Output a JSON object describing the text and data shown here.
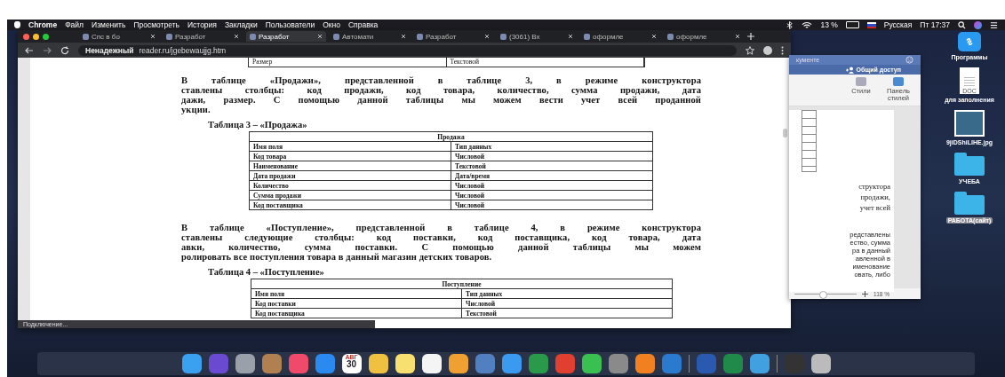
{
  "menu_bar": {
    "app": "Chrome",
    "items": [
      "Файл",
      "Изменить",
      "Просмотреть",
      "История",
      "Закладки",
      "Пользователи",
      "Окно",
      "Справка"
    ],
    "battery": "13 %",
    "input_source": "Русская",
    "clock": "Пт 17:37"
  },
  "browser": {
    "tabs": [
      {
        "label": "Спс в бо",
        "selected": false
      },
      {
        "label": "Разработ",
        "selected": false
      },
      {
        "label": "Разработ",
        "selected": true
      },
      {
        "label": "Автомати",
        "selected": false
      },
      {
        "label": "Разработ",
        "selected": false
      },
      {
        "label": "(3061) Вх",
        "selected": false
      },
      {
        "label": "оформле",
        "selected": false
      },
      {
        "label": "оформле",
        "selected": false
      }
    ],
    "address": {
      "security": "Ненадежный",
      "url": "reader.ru/jgebewaujjg.htm"
    },
    "status": "Подключение...",
    "document": {
      "top_row": [
        "Размер",
        "Текстовой"
      ],
      "paragraph_1": [
        "В таблице «Продажи», представленной в таблице 3, в режиме конструктора",
        "ставлены столбцы: код продажи, код товара, количество, сумма продажи, дата",
        "дажи, размер. С помощью данной таблицы мы можем вести учет всей проданной",
        "укции."
      ],
      "caption_1": "Таблица 3 – «Продажа»",
      "table_1": {
        "title": "Продажа",
        "columns": [
          "Имя поля",
          "Тип данных"
        ],
        "rows": [
          [
            "Код товара",
            "Числовой"
          ],
          [
            "Наименование",
            "Текстовой"
          ],
          [
            "Дата продажи",
            "Дата/время"
          ],
          [
            "Количество",
            "Числовой"
          ],
          [
            "Сумма продажи",
            "Числовой"
          ],
          [
            "Код поставщика",
            "Числовой"
          ]
        ]
      },
      "paragraph_2": [
        "В таблице «Поступление», представленной в таблице 4, в режиме конструктора",
        "ставлены следующие столбцы: код поставки, код поставщика, код товара, дата",
        "авки, количество, сумма поставки. С помощью данной таблицы мы можем",
        "ролировать все поступления товара в данный магазин детских товаров."
      ],
      "caption_2": "Таблица 4 – «Поступление»",
      "table_2": {
        "title": "Поступление",
        "columns": [
          "Имя поля",
          "Тип данных"
        ],
        "rows": [
          [
            "Код поставки",
            "Числовой"
          ],
          [
            "Код поставщика",
            "Текстовой"
          ]
        ]
      }
    }
  },
  "word_window": {
    "title": "кументе",
    "share": "Общий доступ",
    "styles": "Стили",
    "styles_pane": "Панель стилей",
    "big_lines": [
      "структора",
      "продажи,",
      "учет всей"
    ],
    "small_lines": [
      "редставлены",
      "ество, сумма",
      "ра в данный",
      "авленной в",
      "именование",
      "овать, либо"
    ],
    "zoom_slider": {
      "level": 0.45
    },
    "zoom": "118 %"
  },
  "desktop_icons": [
    {
      "kind": "app",
      "label": "Программы",
      "selected": false
    },
    {
      "kind": "doc",
      "label": "для заполнения",
      "badge": "DOC",
      "selected": false
    },
    {
      "kind": "photo",
      "label": "9jiDShiLIHE.jpg",
      "selected": false
    },
    {
      "kind": "folder",
      "label": "УЧЕБА",
      "selected": false
    },
    {
      "kind": "folder",
      "label": "РАБОТА(сайт)",
      "selected": true
    }
  ],
  "dock": {
    "calendar_month": "АВГ",
    "calendar_day": "30"
  }
}
